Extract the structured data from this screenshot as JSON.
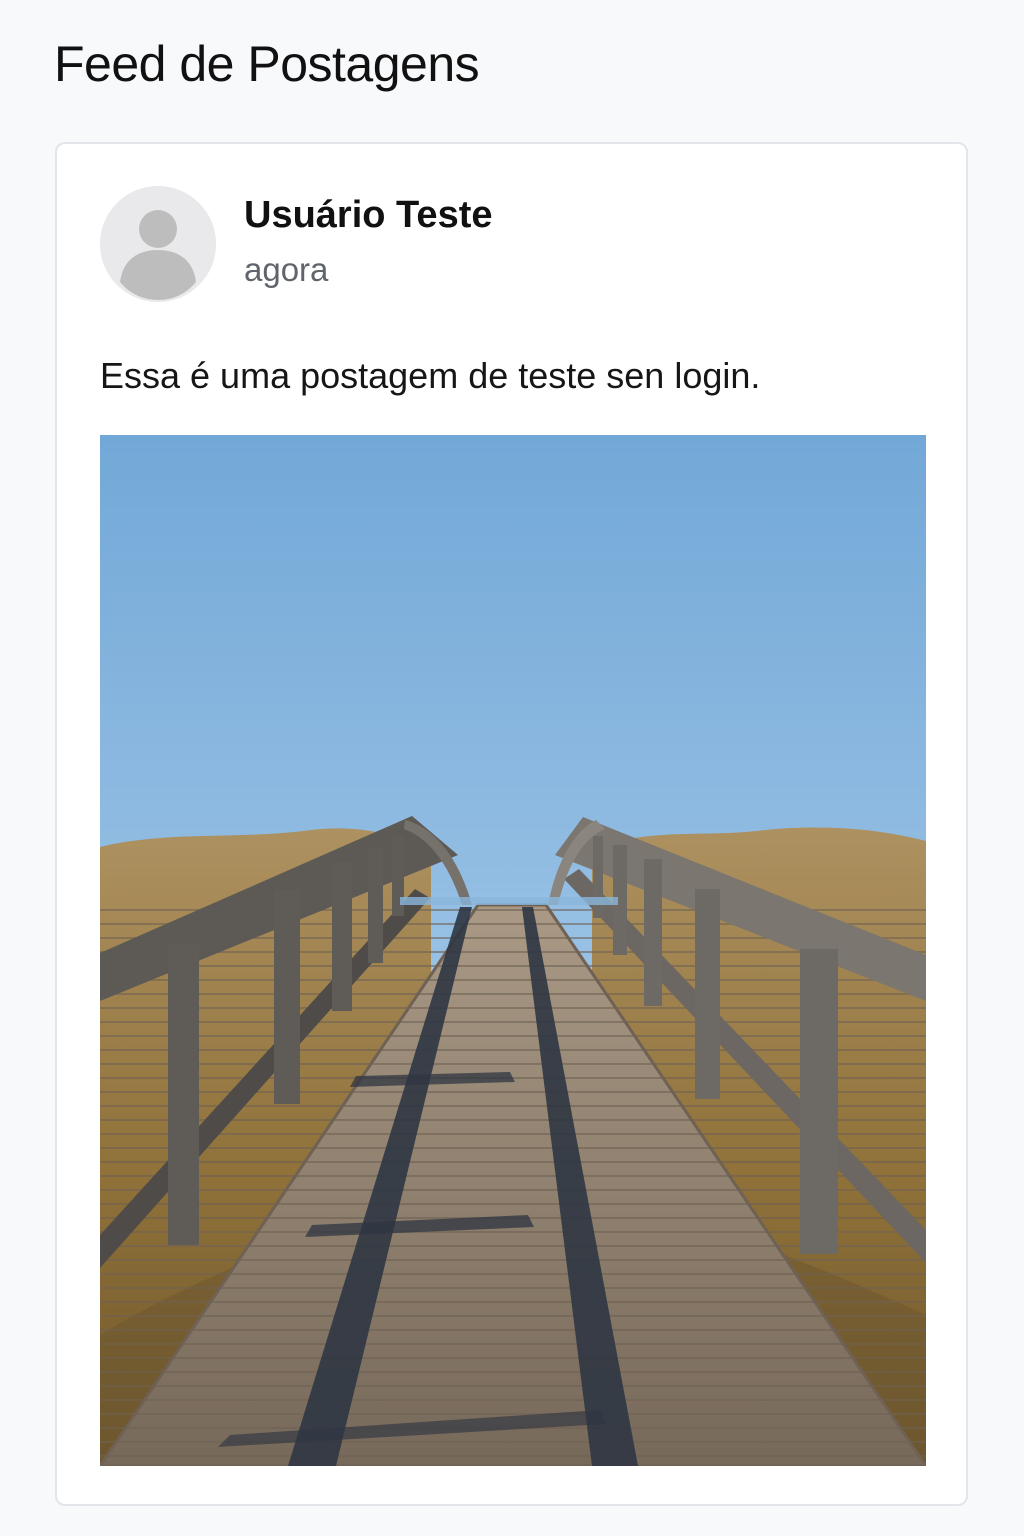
{
  "page": {
    "title": "Feed de Postagens"
  },
  "post": {
    "author": "Usuário Teste",
    "timestamp": "agora",
    "text": "Essa é uma postagem de teste sen login.",
    "avatar_icon": "default-user-avatar-icon"
  },
  "colors": {
    "background": "#f8f9fb",
    "card": "#ffffff",
    "card_border": "#e3e5ea",
    "text_primary": "#111111",
    "text_secondary": "#60646c"
  }
}
